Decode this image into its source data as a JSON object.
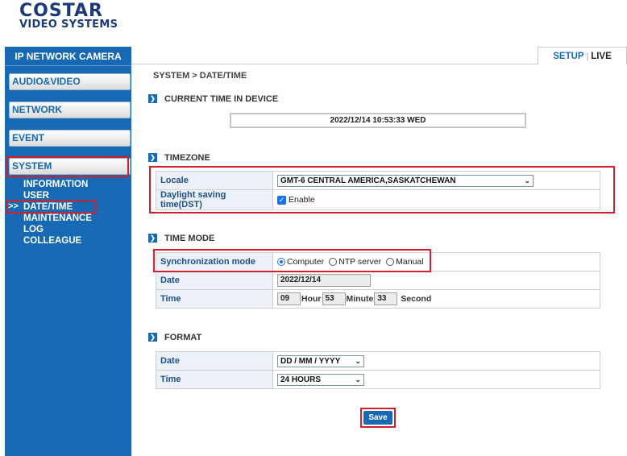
{
  "logo": {
    "line1": "COSTAR",
    "line2": "VIDEO SYSTEMS"
  },
  "sidebar": {
    "title": "IP NETWORK CAMERA",
    "menus": [
      "AUDIO&VIDEO",
      "NETWORK",
      "EVENT",
      "SYSTEM"
    ],
    "system_items": [
      "INFORMATION",
      "USER",
      "DATE/TIME",
      "MAINTENANCE",
      "LOG",
      "COLLEAGUE"
    ],
    "active_marker": ">>"
  },
  "tabs": {
    "setup": "SETUP",
    "separator": "|",
    "live": "LIVE"
  },
  "breadcrumb": "SYSTEM > DATE/TIME",
  "sections": {
    "current_time": {
      "title": "CURRENT TIME IN DEVICE",
      "value": "2022/12/14 10:53:33 WED"
    },
    "timezone": {
      "title": "TIMEZONE",
      "locale_label": "Locale",
      "locale_value": "GMT-6 CENTRAL AMERICA,SASKATCHEWAN",
      "dst_label": "Daylight saving time(DST)",
      "dst_option": "Enable"
    },
    "time_mode": {
      "title": "TIME MODE",
      "sync_label": "Synchronization mode",
      "sync_options": [
        "Computer",
        "NTP server",
        "Manual"
      ],
      "date_label": "Date",
      "date_value": "2022/12/14",
      "time_label": "Time",
      "hour": "09",
      "hour_unit": "Hour",
      "minute": "53",
      "minute_unit": "Minute",
      "second": "33",
      "second_unit": "Second"
    },
    "format": {
      "title": "FORMAT",
      "date_label": "Date",
      "date_value": "DD / MM / YYYY",
      "time_label": "Time",
      "time_value": "24 HOURS"
    }
  },
  "save_label": "Save",
  "colors": {
    "brand_blue": "#1769b3",
    "highlight_red": "#d0202b",
    "label_bg": "#ecf1f8"
  },
  "icons": {
    "section": "chevron-right-icon",
    "dropdown": "chevron-down-icon",
    "checkbox": "check-icon"
  }
}
